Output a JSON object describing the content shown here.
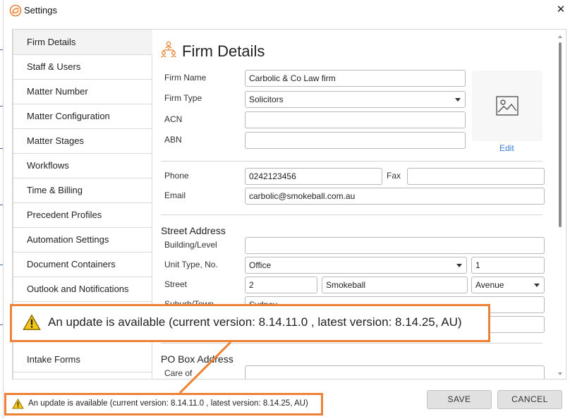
{
  "window": {
    "title": "Settings",
    "close_glyph": "✕"
  },
  "sidebar": {
    "items": [
      {
        "label": "Firm Details",
        "active": true
      },
      {
        "label": "Staff & Users"
      },
      {
        "label": "Matter Number"
      },
      {
        "label": "Matter Configuration"
      },
      {
        "label": "Matter Stages"
      },
      {
        "label": "Workflows"
      },
      {
        "label": "Time & Billing"
      },
      {
        "label": "Precedent Profiles"
      },
      {
        "label": "Automation Settings"
      },
      {
        "label": "Document Containers"
      },
      {
        "label": "Outlook and Notifications"
      },
      {
        "label": ""
      },
      {
        "label": ""
      },
      {
        "label": "Intake Forms"
      },
      {
        "label": ""
      }
    ]
  },
  "firm_details": {
    "title": "Firm Details",
    "firm_name_label": "Firm Name",
    "firm_name_value": "Carbolic & Co Law firm",
    "firm_type_label": "Firm Type",
    "firm_type_value": "Solicitors",
    "acn_label": "ACN",
    "acn_value": "",
    "abn_label": "ABN",
    "abn_value": "",
    "logo_edit": "Edit",
    "phone_label": "Phone",
    "phone_value": "0242123456",
    "fax_label": "Fax",
    "fax_value": "",
    "email_label": "Email",
    "email_value": "carbolic@smokeball.com.au"
  },
  "street_address": {
    "heading": "Street Address",
    "building_label": "Building/Level",
    "building_value": "",
    "unit_label": "Unit Type, No.",
    "unit_type_value": "Office",
    "unit_no_value": "1",
    "street_label": "Street",
    "street_no_value": "2",
    "street_name_value": "Smokeball",
    "street_type_value": "Avenue",
    "suburb_label": "Suburb/Town",
    "suburb_value": "Sydney"
  },
  "po_box": {
    "heading": "PO Box Address",
    "care_of_label": "Care of"
  },
  "buttons": {
    "save": "SAVE",
    "cancel": "CANCEL"
  },
  "status": {
    "message": "An update is available (current version: 8.14.11.0 , latest version: 8.14.25, AU)"
  },
  "callout": {
    "message": "An update is available (current version: 8.14.11.0 , latest version: 8.14.25, AU)"
  },
  "colors": {
    "accent_orange": "#ed8236",
    "link_blue": "#3a7bd5",
    "warning_yellow": "#f5c518"
  },
  "icons": {
    "app_logo": "smokeball-logo-icon",
    "section": "people-hierarchy-icon",
    "logo_placeholder": "image-placeholder-icon",
    "warning": "warning-triangle-icon"
  }
}
